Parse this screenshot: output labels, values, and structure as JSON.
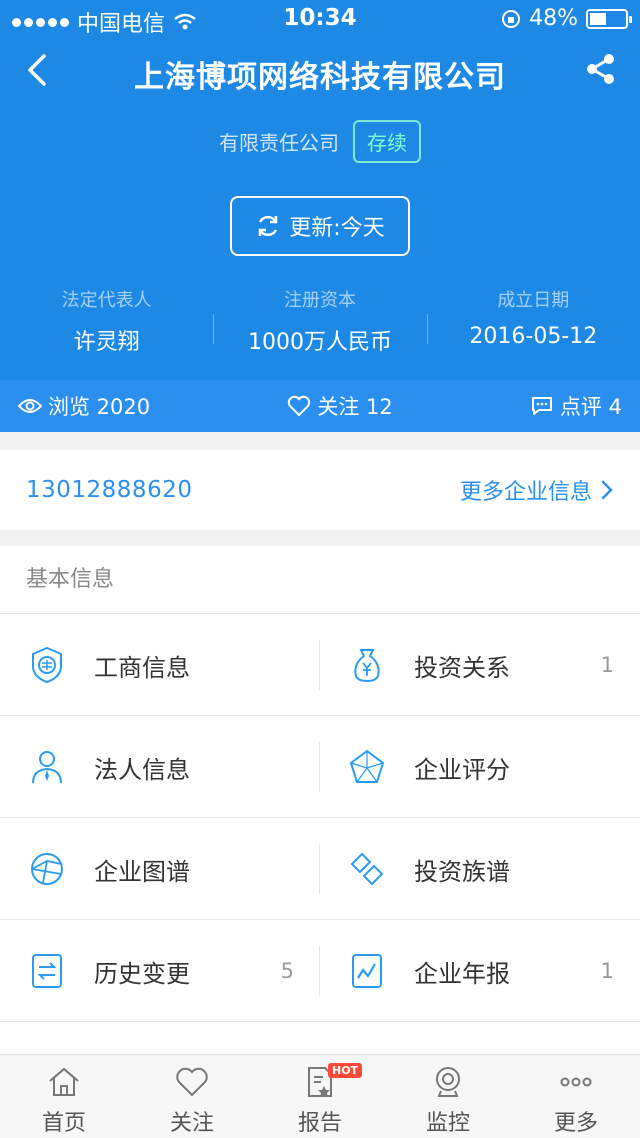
{
  "status_bar": {
    "carrier": "中国电信",
    "time": "10:34",
    "battery": "48%",
    "battery_level": 0.48
  },
  "header": {
    "title": "上海博项网络科技有限公司",
    "company_type": "有限责任公司",
    "status": "存续",
    "update_label": "更新:今天",
    "stats": [
      {
        "label": "法定代表人",
        "value": "许灵翔"
      },
      {
        "label": "注册资本",
        "value": "1000万人民币"
      },
      {
        "label": "成立日期",
        "value": "2016-05-12"
      }
    ],
    "counts": {
      "views": "浏览 2020",
      "follows": "关注 12",
      "comments": "点评 4"
    }
  },
  "contact": {
    "phone": "13012888620",
    "more_label": "更多企业信息"
  },
  "basic_info": {
    "title": "基本信息",
    "items": [
      {
        "label": "工商信息",
        "count": "",
        "icon": "seal-icon"
      },
      {
        "label": "投资关系",
        "count": "1",
        "icon": "money-bag-icon"
      },
      {
        "label": "法人信息",
        "count": "",
        "icon": "person-icon"
      },
      {
        "label": "企业评分",
        "count": "",
        "icon": "pentagon-chart-icon"
      },
      {
        "label": "企业图谱",
        "count": "",
        "icon": "graph-icon"
      },
      {
        "label": "投资族谱",
        "count": "",
        "icon": "link-icon"
      },
      {
        "label": "历史变更",
        "count": "5",
        "icon": "change-icon"
      },
      {
        "label": "企业年报",
        "count": "1",
        "icon": "report-chart-icon"
      }
    ]
  },
  "tabbar": {
    "items": [
      {
        "label": "首页",
        "icon": "home-icon"
      },
      {
        "label": "关注",
        "icon": "heart-icon"
      },
      {
        "label": "报告",
        "icon": "report-icon",
        "badge": "HOT"
      },
      {
        "label": "监控",
        "icon": "camera-icon"
      },
      {
        "label": "更多",
        "icon": "more-icon"
      }
    ]
  },
  "colors": {
    "primary": "#1e88e5",
    "accent": "#2b8ff0",
    "status_badge": "#7fe8d0",
    "hot_badge": "#ff4a3a"
  }
}
